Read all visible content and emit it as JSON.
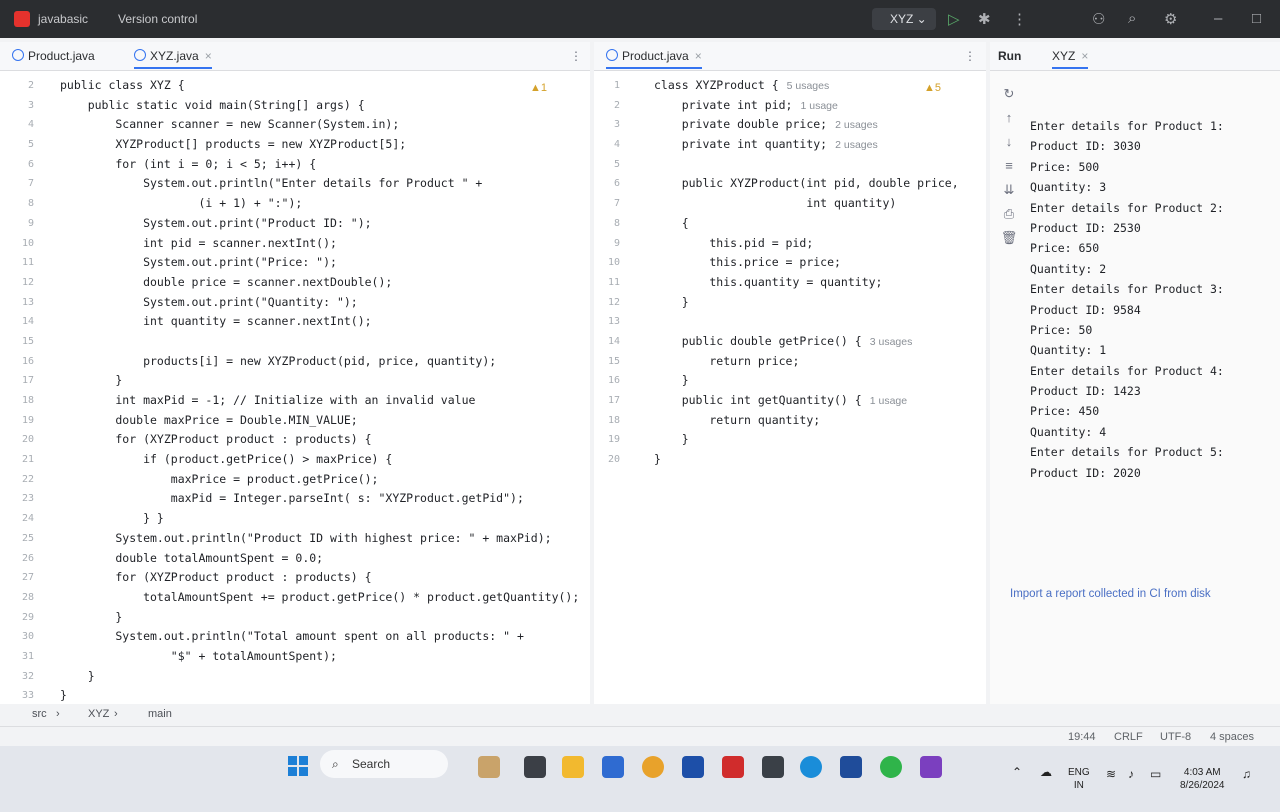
{
  "titlebar": {
    "project": "javabasic",
    "version_control": "Version control",
    "run_config": "XYZ"
  },
  "editor_left": {
    "tabs": [
      {
        "label": "Product.java"
      },
      {
        "label": "XYZ.java"
      }
    ],
    "inspections": "▲1",
    "line_numbers": [
      "2",
      "3",
      "4",
      "5",
      "6",
      "7",
      "8",
      "9",
      "10",
      "11",
      "12",
      "13",
      "14",
      "15",
      "16",
      "17",
      "18",
      "19",
      "20",
      "21",
      "22",
      "23",
      "24",
      "25",
      "26",
      "27",
      "28",
      "29",
      "30",
      "31",
      "32",
      "33"
    ],
    "code": [
      "public class XYZ {",
      "    public static void main(String[] args) {",
      "        Scanner scanner = new Scanner(System.in);",
      "        XYZProduct[] products = new XYZProduct[5];",
      "        for (int i = 0; i < 5; i++) {",
      "            System.out.println(\"Enter details for Product \" +",
      "                    (i + 1) + \":\");",
      "            System.out.print(\"Product ID: \");",
      "            int pid = scanner.nextInt();",
      "            System.out.print(\"Price: \");",
      "            double price = scanner.nextDouble();",
      "            System.out.print(\"Quantity: \");",
      "            int quantity = scanner.nextInt();",
      "",
      "            products[i] = new XYZProduct(pid, price, quantity);",
      "        }",
      "        int maxPid = -1; // Initialize with an invalid value",
      "        double maxPrice = Double.MIN_VALUE;",
      "        for (XYZProduct product : products) {",
      "            if (product.getPrice() > maxPrice) {",
      "                maxPrice = product.getPrice();",
      "                maxPid = Integer.parseInt( s: \"XYZProduct.getPid\");",
      "            } }",
      "        System.out.println(\"Product ID with highest price: \" + maxPid);",
      "        double totalAmountSpent = 0.0;",
      "        for (XYZProduct product : products) {",
      "            totalAmountSpent += product.getPrice() * product.getQuantity();",
      "        }",
      "        System.out.println(\"Total amount spent on all products: \" +",
      "                \"$\" + totalAmountSpent);",
      "    }",
      "}"
    ]
  },
  "editor_right": {
    "tabs": [
      {
        "label": "Product.java"
      }
    ],
    "inspections": "▲5",
    "line_numbers": [
      "1",
      "2",
      "3",
      "4",
      "5",
      "6",
      "7",
      "8",
      "9",
      "10",
      "11",
      "12",
      "13",
      "14",
      "15",
      "16",
      "17",
      "18",
      "19",
      "20"
    ],
    "code": [
      {
        "text": "class XYZProduct {",
        "hint": "5 usages"
      },
      {
        "text": "    private int pid;",
        "hint": "1 usage"
      },
      {
        "text": "    private double price;",
        "hint": "2 usages"
      },
      {
        "text": "    private int quantity;",
        "hint": "2 usages"
      },
      {
        "text": "",
        "hint": ""
      },
      {
        "text": "    public XYZProduct(int pid, double price,",
        "hint": ""
      },
      {
        "text": "                      int quantity)",
        "hint": ""
      },
      {
        "text": "    {",
        "hint": ""
      },
      {
        "text": "        this.pid = pid;",
        "hint": ""
      },
      {
        "text": "        this.price = price;",
        "hint": ""
      },
      {
        "text": "        this.quantity = quantity;",
        "hint": ""
      },
      {
        "text": "    }",
        "hint": ""
      },
      {
        "text": "",
        "hint": ""
      },
      {
        "text": "    public double getPrice() {",
        "hint": "3 usages"
      },
      {
        "text": "        return price;",
        "hint": ""
      },
      {
        "text": "    }",
        "hint": ""
      },
      {
        "text": "    public int getQuantity() {",
        "hint": "1 usage"
      },
      {
        "text": "        return quantity;",
        "hint": ""
      },
      {
        "text": "    }",
        "hint": ""
      },
      {
        "text": "}",
        "hint": ""
      }
    ]
  },
  "run_panel": {
    "title": "Run",
    "tab": "XYZ",
    "output": [
      "Enter details for Product 1:",
      "Product ID: 3030",
      "Price: 500",
      "Quantity: 3",
      "Enter details for Product 2:",
      "Product ID: 2530",
      "Price: 650",
      "Quantity: 2",
      "Enter details for Product 3:",
      "Product ID: 9584",
      "Price: 50",
      "Quantity: 1",
      "Enter details for Product 4:",
      "Product ID: 1423",
      "Price: 450",
      "Quantity: 4",
      "Enter details for Product 5:",
      "Product ID: 2020"
    ],
    "import_link": "Import a report collected in CI from disk"
  },
  "breadcrumb": {
    "items": [
      "src",
      "XYZ",
      "main"
    ]
  },
  "statusbar": {
    "position": "19:44",
    "line_sep": "CRLF",
    "encoding": "UTF-8",
    "indent": "4 spaces"
  },
  "taskbar": {
    "search": "Search",
    "lang": "ENG",
    "region": "IN",
    "time": "4:03 AM",
    "date": "8/26/2024"
  }
}
